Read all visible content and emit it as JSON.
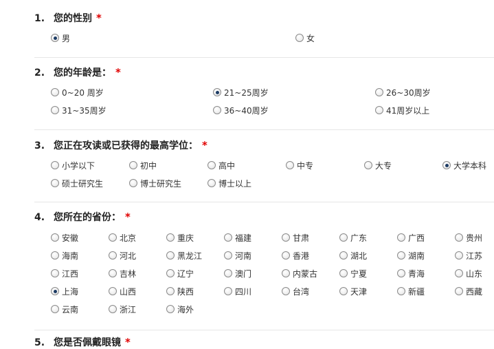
{
  "required_mark": "*",
  "questions": [
    {
      "num": "1.",
      "title": "您的性别",
      "options": [
        "男",
        "女"
      ],
      "selected": 0
    },
    {
      "num": "2.",
      "title": "您的年龄是：",
      "options": [
        "0~20 周岁",
        "21~25周岁",
        "26~30周岁",
        "31~35周岁",
        "36~40周岁",
        "41周岁以上"
      ],
      "selected": 1
    },
    {
      "num": "3.",
      "title": "您正在攻读或已获得的最高学位：",
      "options": [
        "小学以下",
        "初中",
        "高中",
        "中专",
        "大专",
        "大学本科",
        "硕士研究生",
        "博士研究生",
        "博士以上"
      ],
      "selected": 5
    },
    {
      "num": "4.",
      "title": "您所在的省份：",
      "options": [
        "安徽",
        "北京",
        "重庆",
        "福建",
        "甘肃",
        "广东",
        "广西",
        "贵州",
        "海南",
        "河北",
        "黑龙江",
        "河南",
        "香港",
        "湖北",
        "湖南",
        "江苏",
        "江西",
        "吉林",
        "辽宁",
        "澳门",
        "内蒙古",
        "宁夏",
        "青海",
        "山东",
        "上海",
        "山西",
        "陕西",
        "四川",
        "台湾",
        "天津",
        "新疆",
        "西藏",
        "云南",
        "浙江",
        "海外"
      ],
      "selected": 24
    },
    {
      "num": "5.",
      "title": "您是否佩戴眼镜",
      "options": [],
      "selected": -1
    }
  ]
}
